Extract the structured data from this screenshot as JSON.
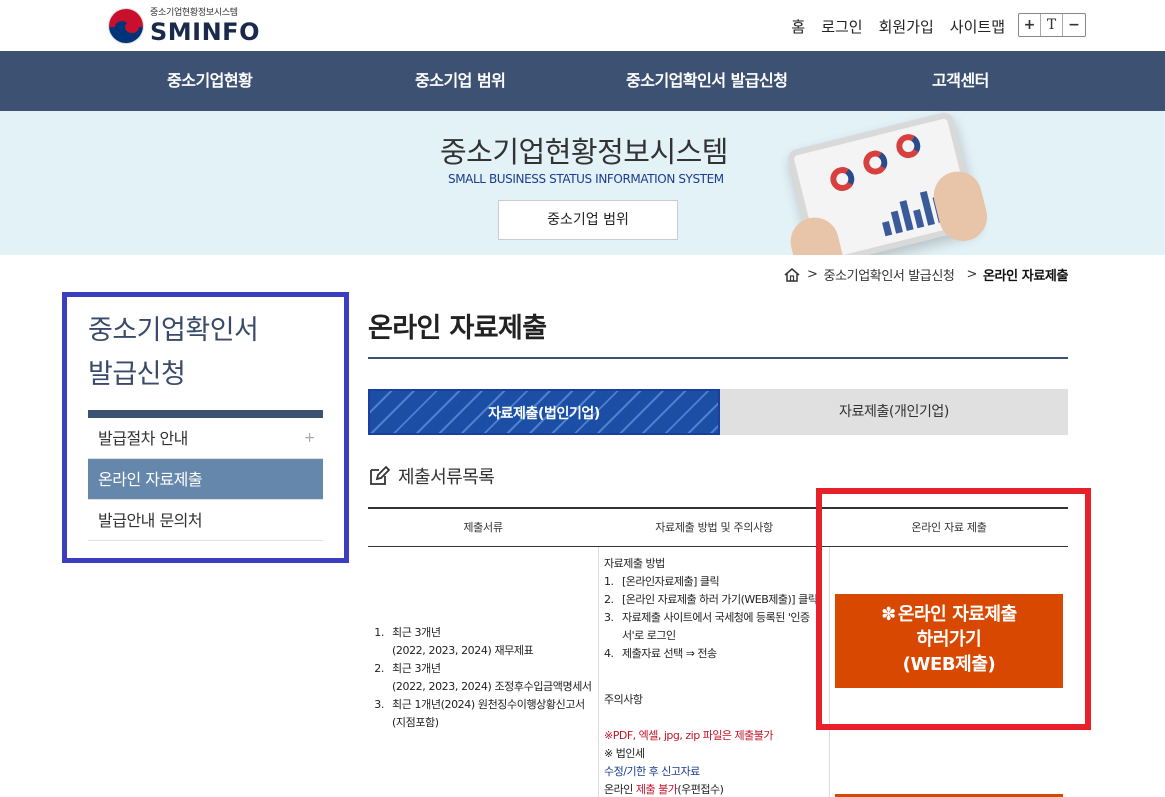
{
  "header": {
    "logo_small": "중소기업현황정보시스템",
    "logo_big": "SMINFO",
    "util_links": [
      "홈",
      "로그인",
      "회원가입",
      "사이트맵"
    ],
    "font_controls": [
      "+",
      "T",
      "−"
    ]
  },
  "gnb": [
    "중소기업현황",
    "중소기업 범위",
    "중소기업확인서 발급신청",
    "고객센터"
  ],
  "banner": {
    "title": "중소기업현황정보시스템",
    "subtitle": "SMALL BUSINESS STATUS INFORMATION SYSTEM",
    "button": "중소기업 범위"
  },
  "breadcrumb": {
    "level1": "중소기업확인서 발급신청",
    "current": "온라인 자료제출"
  },
  "lnb": {
    "title_line1": "중소기업확인서",
    "title_line2": "발급신청",
    "items": [
      {
        "label": "발급절차 안내",
        "has_plus": "+"
      },
      {
        "label": "온라인 자료제출"
      },
      {
        "label": "발급안내 문의처"
      }
    ]
  },
  "content": {
    "title": "온라인 자료제출",
    "tabs": [
      "자료제출(법인기업)",
      "자료제출(개인기업)"
    ],
    "section_title": "제출서류목록",
    "table": {
      "headers": [
        "제출서류",
        "자료제출 방법 및 주의사항",
        "온라인 자료 제출"
      ],
      "docs": [
        {
          "num": "1.",
          "line1": "최근 3개년",
          "line2": "(2022, 2023, 2024) 재무제표"
        },
        {
          "num": "2.",
          "line1": "최근 3개년",
          "line2": "(2022, 2023, 2024) 조정후수입금액명세서"
        },
        {
          "num": "3.",
          "line1": "최근 1개년(2024) 원천징수이행상황신고서",
          "line2": "(지점포함)"
        }
      ],
      "method_heading": "자료제출 방법",
      "method_steps": [
        {
          "num": "1.",
          "text": "[온라인자료제출] 클릭"
        },
        {
          "num": "2.",
          "text": "[온라인 자료제출 하러 가기(WEB제출)] 클릭"
        },
        {
          "num": "3.",
          "text": "자료제출 사이트에서 국세청에 등록된 '인증"
        },
        {
          "num": "",
          "text": "서'로 로그인"
        },
        {
          "num": "4.",
          "text": "제출자료 선택 ⇒ 전송"
        }
      ],
      "caution_heading": "주의사항",
      "caution_red": "※PDF, 엑셀, jpg, zip 파일은 제출불가",
      "caution_corp": "※ 법인세",
      "caution_blue": "수정/기한 후 신고자료",
      "caution_last_a": "온라인 ",
      "caution_last_b": "제출 불가",
      "caution_last_c": "(우편접수)",
      "submit_line1": "온라인 자료제출",
      "submit_line2": "하러가기",
      "submit_line3": "(WEB제출)"
    }
  },
  "colors": {
    "nav": "#3d5172",
    "accent_orange": "#d94800",
    "highlight_blue": "#3b3fbf",
    "highlight_red": "#e8202a"
  }
}
